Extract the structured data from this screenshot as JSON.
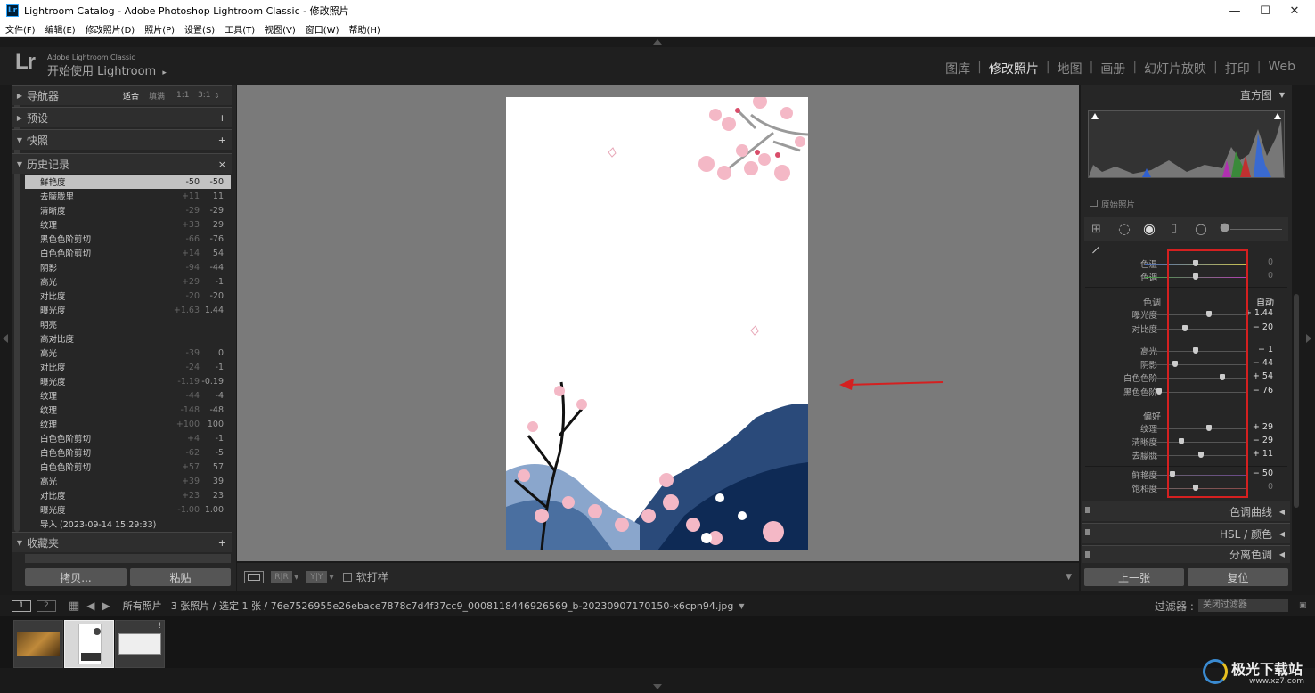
{
  "window": {
    "title": "Lightroom Catalog - Adobe Photoshop Lightroom Classic - 修改照片",
    "app_icon": "Lr",
    "minimize": "—",
    "maximize": "☐",
    "close": "✕"
  },
  "menu": [
    "文件(F)",
    "编辑(E)",
    "修改照片(D)",
    "照片(P)",
    "设置(S)",
    "工具(T)",
    "视图(V)",
    "窗口(W)",
    "帮助(H)"
  ],
  "identity": {
    "logo": "Lr",
    "sub": "Adobe Lightroom Classic",
    "greeting": "开始使用 Lightroom",
    "greeting_arrow": "▸"
  },
  "modules": [
    {
      "label": "图库",
      "active": false
    },
    {
      "label": "修改照片",
      "active": true
    },
    {
      "label": "地图",
      "active": false
    },
    {
      "label": "画册",
      "active": false
    },
    {
      "label": "幻灯片放映",
      "active": false
    },
    {
      "label": "打印",
      "active": false
    },
    {
      "label": "Web",
      "active": false
    }
  ],
  "left": {
    "navigator": {
      "label": "导航器",
      "zoom": [
        "适合",
        "填满",
        "1:1",
        "3:1"
      ]
    },
    "presets": {
      "label": "预设",
      "action": "+"
    },
    "snapshots": {
      "label": "快照",
      "action": "+"
    },
    "history": {
      "label": "历史记录",
      "action": "×"
    },
    "history_items": [
      {
        "name": "鲜艳度",
        "delta": "-50",
        "value": "-50"
      },
      {
        "name": "去朦胧里",
        "delta": "+11",
        "value": "11"
      },
      {
        "name": "清晰度",
        "delta": "-29",
        "value": "-29"
      },
      {
        "name": "纹理",
        "delta": "+33",
        "value": "29"
      },
      {
        "name": "黑色色阶剪切",
        "delta": "-66",
        "value": "-76"
      },
      {
        "name": "白色色阶剪切",
        "delta": "+14",
        "value": "54"
      },
      {
        "name": "阴影",
        "delta": "-94",
        "value": "-44"
      },
      {
        "name": "高光",
        "delta": "+29",
        "value": "-1"
      },
      {
        "name": "对比度",
        "delta": "-20",
        "value": "-20"
      },
      {
        "name": "曝光度",
        "delta": "+1.63",
        "value": "1.44"
      },
      {
        "name": "明亮",
        "delta": "",
        "value": ""
      },
      {
        "name": "高对比度",
        "delta": "",
        "value": ""
      },
      {
        "name": "高光",
        "delta": "-39",
        "value": "0"
      },
      {
        "name": "对比度",
        "delta": "-24",
        "value": "-1"
      },
      {
        "name": "曝光度",
        "delta": "-1.19",
        "value": "-0.19"
      },
      {
        "name": "纹理",
        "delta": "-44",
        "value": "-4"
      },
      {
        "name": "纹理",
        "delta": "-148",
        "value": "-48"
      },
      {
        "name": "纹理",
        "delta": "+100",
        "value": "100"
      },
      {
        "name": "白色色阶剪切",
        "delta": "+4",
        "value": "-1"
      },
      {
        "name": "白色色阶剪切",
        "delta": "-62",
        "value": "-5"
      },
      {
        "name": "白色色阶剪切",
        "delta": "+57",
        "value": "57"
      },
      {
        "name": "高光",
        "delta": "+39",
        "value": "39"
      },
      {
        "name": "对比度",
        "delta": "+23",
        "value": "23"
      },
      {
        "name": "曝光度",
        "delta": "-1.00",
        "value": "1.00"
      },
      {
        "name": "导入 (2023-09-14 15:29:33)",
        "delta": "",
        "value": ""
      }
    ],
    "collections": {
      "label": "收藏夹",
      "action": "+"
    },
    "copy_button": "拷贝...",
    "paste_button": "粘贴"
  },
  "toolbar": {
    "soft_proof": "软打样"
  },
  "right": {
    "histogram": {
      "label": "直方图",
      "original_photo": "原始照片"
    },
    "basic": {
      "wb": [
        {
          "label": "色温",
          "value": "0",
          "pos": 0.5
        },
        {
          "label": "色调",
          "value": "0",
          "pos": 0.5
        }
      ],
      "tone_label": "色调",
      "auto": "自动",
      "tone": [
        {
          "label": "曝光度",
          "value": "+ 1.44",
          "pos": 0.64
        },
        {
          "label": "对比度",
          "value": "− 20",
          "pos": 0.4
        },
        {
          "label": "高光",
          "value": "− 1",
          "pos": 0.5
        },
        {
          "label": "阴影",
          "value": "− 44",
          "pos": 0.3
        },
        {
          "label": "白色色阶",
          "value": "+ 54",
          "pos": 0.77
        },
        {
          "label": "黑色色阶",
          "value": "− 76",
          "pos": 0.14
        }
      ],
      "presence_label": "偏好",
      "presence": [
        {
          "label": "纹理",
          "value": "+ 29",
          "pos": 0.64
        },
        {
          "label": "清晰度",
          "value": "− 29",
          "pos": 0.36
        },
        {
          "label": "去朦胧",
          "value": "+ 11",
          "pos": 0.56
        },
        {
          "label": "鲜艳度",
          "value": "− 50",
          "pos": 0.27
        },
        {
          "label": "饱和度",
          "value": "0",
          "pos": 0.5
        }
      ]
    },
    "tone_curve": "色调曲线",
    "hsl": "HSL / 颜色",
    "split": "分离色调",
    "prev_button": "上一张",
    "reset_button": "复位"
  },
  "filmstrip": {
    "page1": "1",
    "page2": "2",
    "source": "所有照片",
    "info": "3 张照片 / 选定 1 张 / 76e7526955e26ebace7878c7d4f37cc9_0008118446926569_b-20230907170150-x6cpn94.jpg",
    "filter_label": "过滤器 :",
    "filter_value": "关闭过滤器"
  },
  "watermark": {
    "text": "极光下载站",
    "url": "www.xz7.com"
  },
  "colors": {
    "accent_red": "#d42020",
    "panel": "#262626",
    "canvas": "#7a7a7a"
  }
}
